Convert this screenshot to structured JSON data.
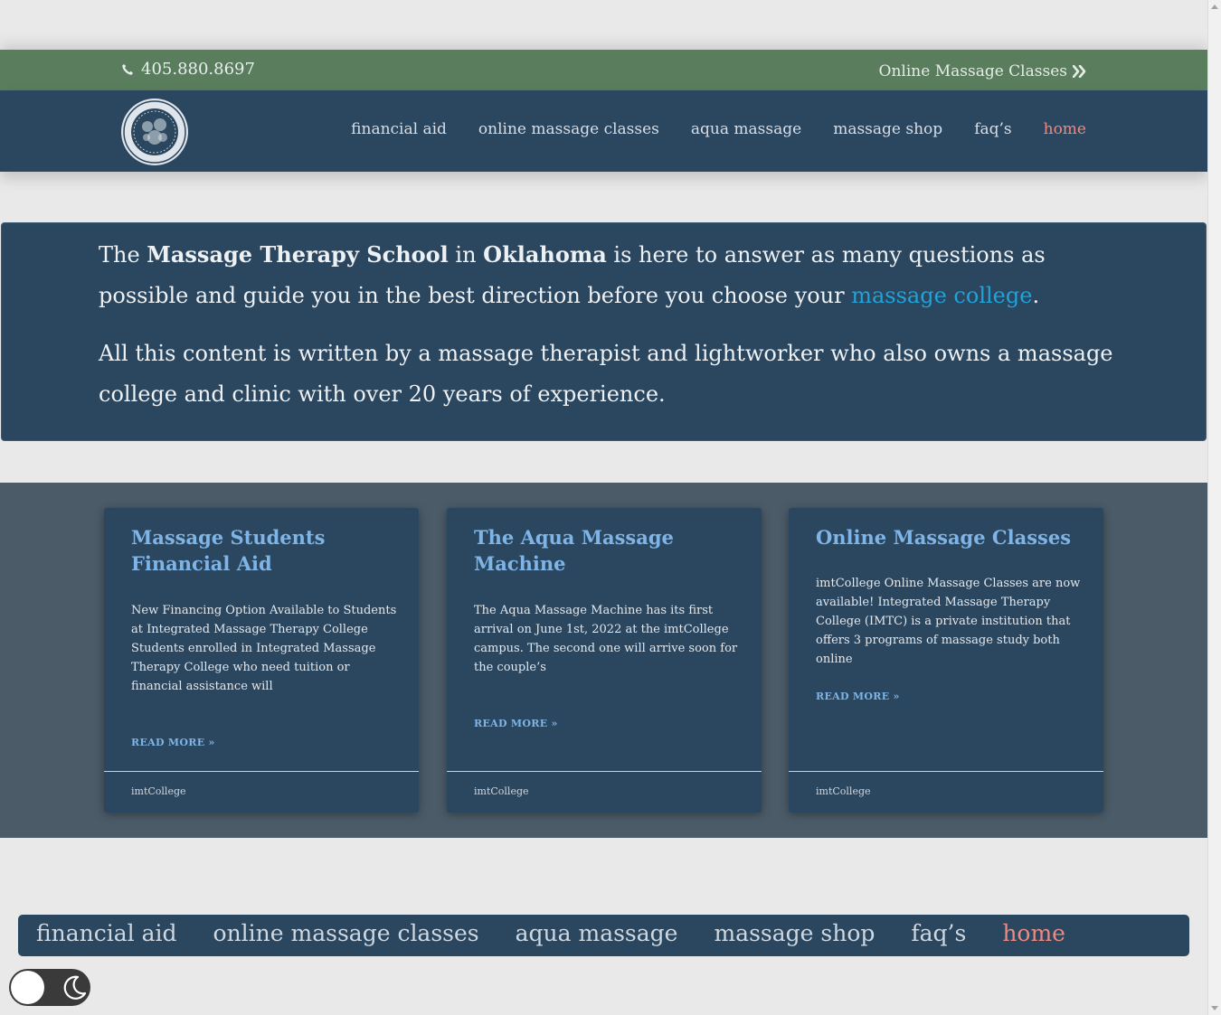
{
  "topbar": {
    "phone": "405.880.8697",
    "right_link": "Online Massage Classes"
  },
  "nav": {
    "items": [
      {
        "label": "financial aid"
      },
      {
        "label": "online massage classes"
      },
      {
        "label": "aqua massage"
      },
      {
        "label": "massage shop"
      },
      {
        "label": "faq’s"
      },
      {
        "label": "home"
      }
    ]
  },
  "hero": {
    "p1_a": "The ",
    "p1_b": "Massage Therapy School",
    "p1_c": " in ",
    "p1_d": "Oklahoma",
    "p1_e": " is here to answer as many questions as possible and guide you in the best direction before you choose your ",
    "p1_link": "massage college",
    "p1_f": ".",
    "p2": "All this content is written by a massage therapist and lightworker who also owns a massage college and clinic with over 20 years of experience."
  },
  "cards": [
    {
      "title": "Massage Students Financial Aid",
      "excerpt": "New Financing Option Available to Students at Integrated Massage Therapy College Students enrolled in Integrated Massage Therapy College who need tuition or financial assistance will",
      "read_more": "READ MORE »",
      "author": "imtCollege"
    },
    {
      "title": "The Aqua Massage Machine",
      "excerpt": "The Aqua Massage Machine has its first arrival on June 1st, 2022 at the imtCollege campus. The second one will arrive soon for the couple’s",
      "read_more": "READ MORE »",
      "author": "imtCollege"
    },
    {
      "title": "Online Massage Classes",
      "excerpt": "imtCollege Online Massage Classes are now available! Integrated Massage Therapy College (IMTC) is a private institution that offers 3 programs of massage study both online",
      "read_more": "READ MORE »",
      "author": "imtCollege"
    }
  ],
  "footer_menu": {
    "items": [
      {
        "label": "financial aid"
      },
      {
        "label": "online massage classes"
      },
      {
        "label": "aqua massage"
      },
      {
        "label": "massage shop"
      },
      {
        "label": "faq’s"
      },
      {
        "label": "home"
      }
    ]
  },
  "colors": {
    "navy": "#2b4760",
    "green_bar": "#5a7d5e",
    "band": "#4b5b68",
    "accent_link": "#1fa3d9",
    "active_link": "#ec8a82",
    "card_title": "#7fb4e6"
  },
  "icons": {
    "phone": "phone-icon",
    "chevrons": "double-chevron-right-icon",
    "logo": "college-seal-logo",
    "theme_toggle": "moon-icon"
  }
}
